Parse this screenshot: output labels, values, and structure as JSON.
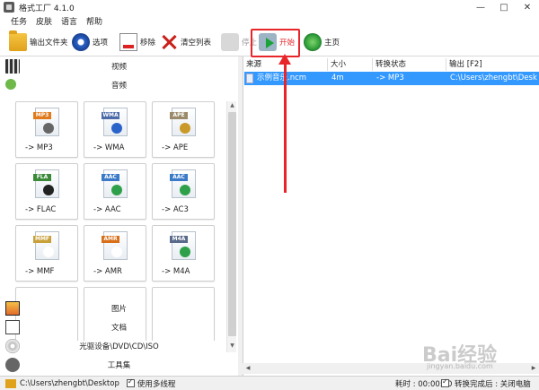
{
  "window": {
    "title": "格式工厂 4.1.0"
  },
  "window_controls": {
    "minimize": "—",
    "maximize": "□",
    "close": "✕"
  },
  "menu": [
    "任务",
    "皮肤",
    "语言",
    "帮助"
  ],
  "toolbar": {
    "output_folder": "输出文件夹",
    "options": "选项",
    "remove": "移除",
    "clear_list": "清空列表",
    "stop": "停止",
    "start": "开始",
    "home": "主页"
  },
  "categories": {
    "video": "视频",
    "audio": "音频",
    "picture": "图片",
    "document": "文档",
    "disc": "光驱设备\\DVD\\CD\\ISO",
    "tools": "工具集"
  },
  "formats": [
    {
      "tag": "MP3",
      "label": "-> MP3",
      "tag_color": "#e07a1a",
      "glyph_color": "#666"
    },
    {
      "tag": "WMA",
      "label": "-> WMA",
      "tag_color": "#4a6aa8",
      "glyph_color": "#2a63c9"
    },
    {
      "tag": "APE",
      "label": "-> APE",
      "tag_color": "#9a8a6a",
      "glyph_color": "#c99a2a"
    },
    {
      "tag": "FLA",
      "label": "-> FLAC",
      "tag_color": "#3a8a3a",
      "glyph_color": "#222"
    },
    {
      "tag": "AAC",
      "label": "-> AAC",
      "tag_color": "#3a7ac8",
      "glyph_color": "#2fa04a"
    },
    {
      "tag": "AAC",
      "label": "-> AC3",
      "tag_color": "#3a7ac8",
      "glyph_color": "#2fa04a"
    },
    {
      "tag": "MMF",
      "label": "-> MMF",
      "tag_color": "#c8a03a",
      "glyph_color": "#ffffff"
    },
    {
      "tag": "AMR",
      "label": "-> AMR",
      "tag_color": "#d8701a",
      "glyph_color": "#ffffff"
    },
    {
      "tag": "M4A",
      "label": "-> M4A",
      "tag_color": "#5a6a8a",
      "glyph_color": "#2fa04a"
    }
  ],
  "task_columns": {
    "source": "来源",
    "size": "大小",
    "status": "转换状态",
    "output": "输出 [F2]"
  },
  "tasks": [
    {
      "source": "示例音乐.ncm",
      "size": "4m",
      "status": "-> MP3",
      "output": "C:\\Users\\zhengbt\\Desk"
    }
  ],
  "status": {
    "output_path": "C:\\Users\\zhengbt\\Desktop",
    "multithread_label": "使用多线程",
    "elapsed_label": "耗时 : 00:00:00",
    "after_convert_label": "转换完成后 : 关闭电脑"
  },
  "watermark": {
    "main": "Bai经验",
    "sub": "jingyan.baidu.com"
  },
  "colors": {
    "accent_red": "#e8262a",
    "selection": "#3399ff"
  }
}
